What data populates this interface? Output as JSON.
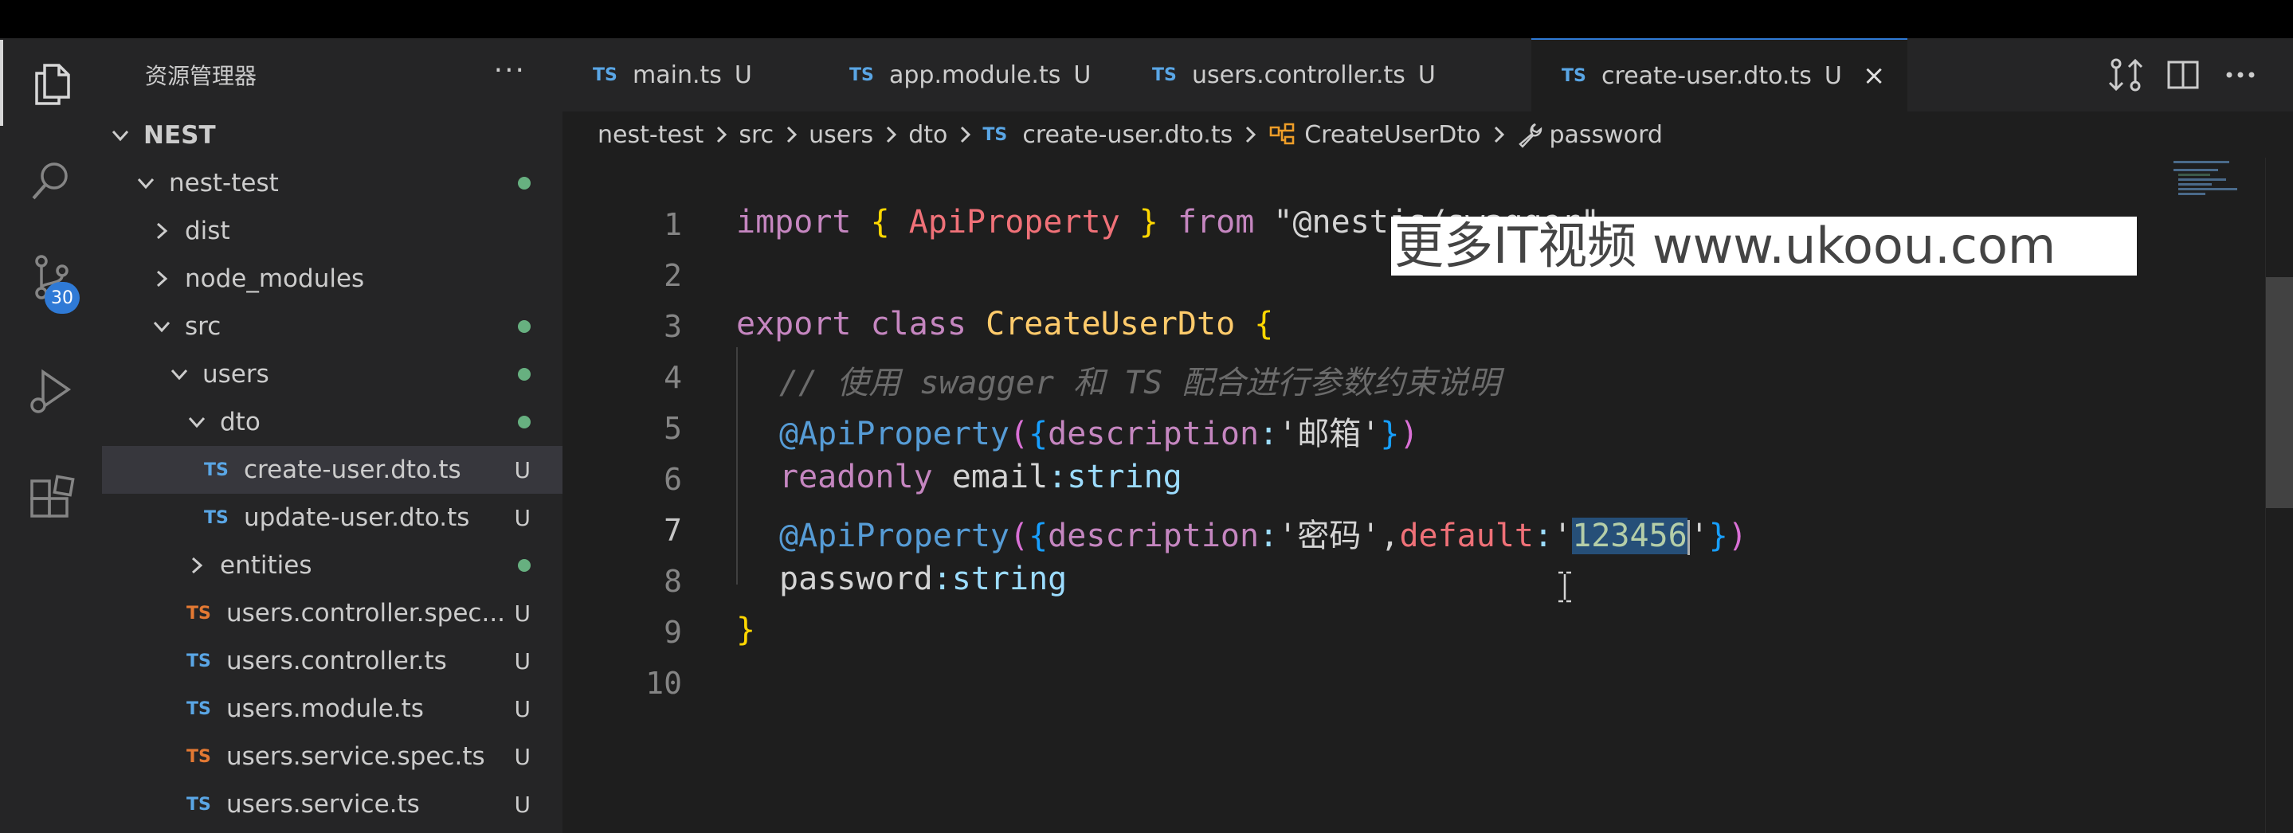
{
  "activity_bar": {
    "items": [
      {
        "name": "explorer",
        "icon": "files-icon"
      },
      {
        "name": "search",
        "icon": "search-icon"
      },
      {
        "name": "source-control",
        "icon": "source-control-icon",
        "badge": "30"
      },
      {
        "name": "run-debug",
        "icon": "run-debug-icon"
      },
      {
        "name": "extensions",
        "icon": "extensions-icon"
      }
    ]
  },
  "sidebar": {
    "title": "资源管理器",
    "more": "···",
    "root": "NEST",
    "tree": [
      {
        "label": "nest-test",
        "type": "folder",
        "open": true,
        "depth": 1,
        "status": "dot"
      },
      {
        "label": "dist",
        "type": "folder",
        "open": false,
        "depth": 2,
        "status": ""
      },
      {
        "label": "node_modules",
        "type": "folder",
        "open": false,
        "depth": 2,
        "status": ""
      },
      {
        "label": "src",
        "type": "folder",
        "open": true,
        "depth": 2,
        "status": "dot"
      },
      {
        "label": "users",
        "type": "folder",
        "open": true,
        "depth": 3,
        "status": "dot"
      },
      {
        "label": "dto",
        "type": "folder",
        "open": true,
        "depth": 4,
        "status": "dot"
      },
      {
        "label": "create-user.dto.ts",
        "type": "ts",
        "depth": 5,
        "status": "U",
        "selected": true
      },
      {
        "label": "update-user.dto.ts",
        "type": "ts",
        "depth": 5,
        "status": "U"
      },
      {
        "label": "entities",
        "type": "folder",
        "open": false,
        "depth": 4,
        "status": "dot"
      },
      {
        "label": "users.controller.spec...",
        "type": "ts-spec",
        "depth": 4,
        "status": "U"
      },
      {
        "label": "users.controller.ts",
        "type": "ts",
        "depth": 4,
        "status": "U"
      },
      {
        "label": "users.module.ts",
        "type": "ts",
        "depth": 4,
        "status": "U"
      },
      {
        "label": "users.service.spec.ts",
        "type": "ts-spec",
        "depth": 4,
        "status": "U"
      },
      {
        "label": "users.service.ts",
        "type": "ts",
        "depth": 4,
        "status": "U"
      }
    ],
    "ts_badge": "TS"
  },
  "tabs": [
    {
      "label": "main.ts",
      "mark": "U",
      "active": false
    },
    {
      "label": "app.module.ts",
      "mark": "U",
      "active": false
    },
    {
      "label": "users.controller.ts",
      "mark": "U",
      "active": false
    },
    {
      "label": "create-user.dto.ts",
      "mark": "U",
      "active": true,
      "close": "×"
    }
  ],
  "breadcrumb": {
    "items": [
      "nest-test",
      "src",
      "users",
      "dto",
      "create-user.dto.ts",
      "CreateUserDto",
      "password"
    ]
  },
  "editor": {
    "line_numbers": [
      "1",
      "2",
      "3",
      "4",
      "5",
      "6",
      "7",
      "8",
      "9",
      "10"
    ],
    "current_line": "7",
    "code": {
      "l1": {
        "import": "import",
        "open": "{",
        "name": "ApiProperty",
        "close": "}",
        "from": "from",
        "module": "\"@nestjs/swagger\""
      },
      "l3": {
        "export": "export",
        "class": "class",
        "name": "CreateUserDto",
        "open": "{"
      },
      "l4": {
        "comment": "// 使用 swagger 和 TS 配合进行参数约束说明"
      },
      "l5": {
        "decorator": "@ApiProperty",
        "p_open": "(",
        "b_open": "{",
        "key": "description",
        "colon": ":",
        "value": "'邮箱'",
        "b_close": "}",
        "p_close": ")"
      },
      "l6": {
        "readonly": "readonly",
        "prop": "email",
        "colon": ":",
        "type": "string"
      },
      "l7": {
        "decorator": "@ApiProperty",
        "p_open": "(",
        "b_open": "{",
        "key": "description",
        "colon": ":",
        "value": "'密码'",
        "comma": ",",
        "key2": "default",
        "colon2": ":",
        "q_open": "'",
        "value2": "123456",
        "q_close": "'",
        "b_close": "}",
        "p_close": ")"
      },
      "l8": {
        "prop": "password",
        "colon": ":",
        "type": "string"
      },
      "l9": {
        "close": "}"
      }
    }
  },
  "watermark": "更多IT视频 www.ukoou.com",
  "colors": {
    "accent": "#2f7ad6",
    "ts_icon": "#5aa6e5",
    "spec_icon": "#e37933",
    "git_untracked": "#73c991"
  }
}
